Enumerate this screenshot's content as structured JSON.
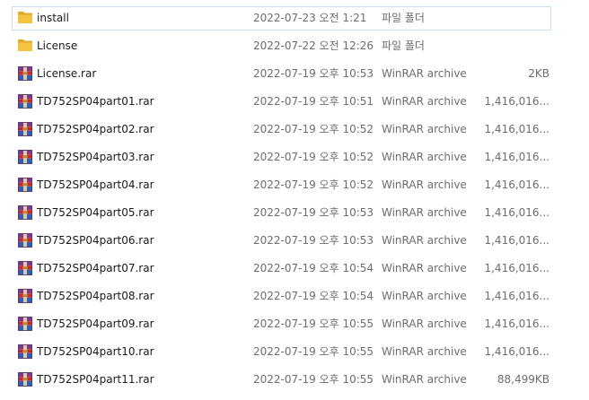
{
  "files": [
    {
      "name": "install",
      "date": "2022-07-23 오전 1:21",
      "type": "파일 폴더",
      "size": "",
      "icon": "folder-icon",
      "selected": true
    },
    {
      "name": "License",
      "date": "2022-07-22 오전 12:26",
      "type": "파일 폴더",
      "size": "",
      "icon": "folder-icon",
      "selected": false
    },
    {
      "name": "License.rar",
      "date": "2022-07-19 오후 10:53",
      "type": "WinRAR archive",
      "size": "2KB",
      "icon": "winrar-archive-icon",
      "selected": false
    },
    {
      "name": "TD752SP04part01.rar",
      "date": "2022-07-19 오후 10:51",
      "type": "WinRAR archive",
      "size": "1,416,016...",
      "icon": "winrar-archive-icon",
      "selected": false
    },
    {
      "name": "TD752SP04part02.rar",
      "date": "2022-07-19 오후 10:52",
      "type": "WinRAR archive",
      "size": "1,416,016...",
      "icon": "winrar-archive-icon",
      "selected": false
    },
    {
      "name": "TD752SP04part03.rar",
      "date": "2022-07-19 오후 10:52",
      "type": "WinRAR archive",
      "size": "1,416,016...",
      "icon": "winrar-archive-icon",
      "selected": false
    },
    {
      "name": "TD752SP04part04.rar",
      "date": "2022-07-19 오후 10:52",
      "type": "WinRAR archive",
      "size": "1,416,016...",
      "icon": "winrar-archive-icon",
      "selected": false
    },
    {
      "name": "TD752SP04part05.rar",
      "date": "2022-07-19 오후 10:53",
      "type": "WinRAR archive",
      "size": "1,416,016...",
      "icon": "winrar-archive-icon",
      "selected": false
    },
    {
      "name": "TD752SP04part06.rar",
      "date": "2022-07-19 오후 10:53",
      "type": "WinRAR archive",
      "size": "1,416,016...",
      "icon": "winrar-archive-icon",
      "selected": false
    },
    {
      "name": "TD752SP04part07.rar",
      "date": "2022-07-19 오후 10:54",
      "type": "WinRAR archive",
      "size": "1,416,016...",
      "icon": "winrar-archive-icon",
      "selected": false
    },
    {
      "name": "TD752SP04part08.rar",
      "date": "2022-07-19 오후 10:54",
      "type": "WinRAR archive",
      "size": "1,416,016...",
      "icon": "winrar-archive-icon",
      "selected": false
    },
    {
      "name": "TD752SP04part09.rar",
      "date": "2022-07-19 오후 10:55",
      "type": "WinRAR archive",
      "size": "1,416,016...",
      "icon": "winrar-archive-icon",
      "selected": false
    },
    {
      "name": "TD752SP04part10.rar",
      "date": "2022-07-19 오후 10:55",
      "type": "WinRAR archive",
      "size": "1,416,016...",
      "icon": "winrar-archive-icon",
      "selected": false
    },
    {
      "name": "TD752SP04part11.rar",
      "date": "2022-07-19 오후 10:55",
      "type": "WinRAR archive",
      "size": "88,499KB",
      "icon": "winrar-archive-icon",
      "selected": false
    }
  ],
  "colors": {
    "selection_border": "#c9dff5",
    "folder": "#f5c342",
    "rar_purple": "#7b3a8c",
    "rar_red": "#c8282d",
    "rar_blue": "#2d5fb4",
    "text_primary": "#1a1a1a",
    "text_secondary": "#6d6d6d"
  }
}
